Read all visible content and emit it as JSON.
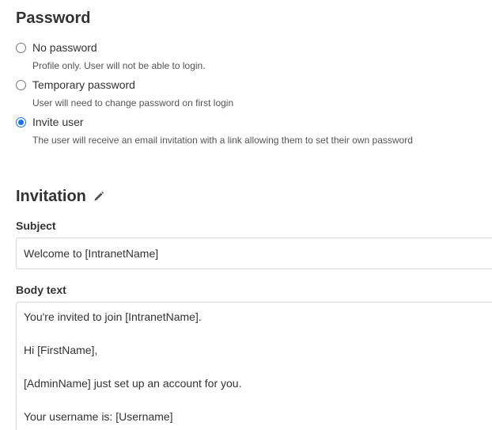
{
  "password_section": {
    "title": "Password",
    "options": [
      {
        "label": "No password",
        "description": "Profile only. User will not be able to login.",
        "selected": false
      },
      {
        "label": "Temporary password",
        "description": "User will need to change password on first login",
        "selected": false
      },
      {
        "label": "Invite user",
        "description": "The user will receive an email invitation with a link allowing them to set their own password",
        "selected": true
      }
    ]
  },
  "invitation_section": {
    "title": "Invitation",
    "edit_icon": "pencil-icon",
    "subject_label": "Subject",
    "subject_value": "Welcome to [IntranetName]",
    "body_label": "Body text",
    "body_lines": [
      "You're invited to join [IntranetName].",
      "",
      "Hi [FirstName],",
      "",
      "[AdminName] just set up an account for you.",
      "",
      "Your username is: [Username]"
    ]
  },
  "colors": {
    "accent": "#1a73e8",
    "text": "#333333",
    "muted": "#555555",
    "border": "#d6d6d6"
  }
}
